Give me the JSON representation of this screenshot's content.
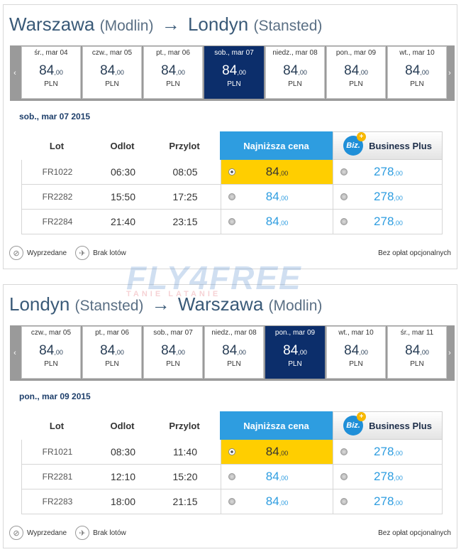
{
  "outbound": {
    "route": {
      "from": "Warszawa",
      "from_sub": "(Modlin)",
      "arrow": "→",
      "to": "Londyn",
      "to_sub": "(Stansted)"
    },
    "nav": {
      "prev": "‹",
      "next": "›"
    },
    "days": [
      {
        "label": "śr., mar 04",
        "price": "84",
        "decimals": ",00",
        "currency": "PLN",
        "selected": false
      },
      {
        "label": "czw., mar 05",
        "price": "84",
        "decimals": ",00",
        "currency": "PLN",
        "selected": false
      },
      {
        "label": "pt., mar 06",
        "price": "84",
        "decimals": ",00",
        "currency": "PLN",
        "selected": false
      },
      {
        "label": "sob., mar 07",
        "price": "84",
        "decimals": ",00",
        "currency": "PLN",
        "selected": true
      },
      {
        "label": "niedz., mar 08",
        "price": "84",
        "decimals": ",00",
        "currency": "PLN",
        "selected": false
      },
      {
        "label": "pon., mar 09",
        "price": "84",
        "decimals": ",00",
        "currency": "PLN",
        "selected": false
      },
      {
        "label": "wt., mar 10",
        "price": "84",
        "decimals": ",00",
        "currency": "PLN",
        "selected": false
      }
    ],
    "selected_date": "sob., mar 07 2015",
    "headers": {
      "flight": "Lot",
      "departure": "Odlot",
      "arrival": "Przylot",
      "lowest": "Najniższa cena",
      "biz_logo": "Biz.",
      "business": "Business Plus"
    },
    "flights": [
      {
        "code": "FR1022",
        "departure": "06:30",
        "arrival": "08:05",
        "low_price": "84",
        "low_dec": ",00",
        "biz_price": "278",
        "biz_dec": ",00",
        "selected": true
      },
      {
        "code": "FR2282",
        "departure": "15:50",
        "arrival": "17:25",
        "low_price": "84",
        "low_dec": ",00",
        "biz_price": "278",
        "biz_dec": ",00",
        "selected": false
      },
      {
        "code": "FR2284",
        "departure": "21:40",
        "arrival": "23:15",
        "low_price": "84",
        "low_dec": ",00",
        "biz_price": "278",
        "biz_dec": ",00",
        "selected": false
      }
    ],
    "legend": {
      "sold_out": "Wyprzedane",
      "no_flights": "Brak lotów",
      "fees": "Bez opłat opcjonalnych"
    }
  },
  "return": {
    "route": {
      "from": "Londyn",
      "from_sub": "(Stansted)",
      "arrow": "→",
      "to": "Warszawa",
      "to_sub": "(Modlin)"
    },
    "nav": {
      "prev": "‹",
      "next": "›"
    },
    "days": [
      {
        "label": "czw., mar 05",
        "price": "84",
        "decimals": ",00",
        "currency": "PLN",
        "selected": false
      },
      {
        "label": "pt., mar 06",
        "price": "84",
        "decimals": ",00",
        "currency": "PLN",
        "selected": false
      },
      {
        "label": "sob., mar 07",
        "price": "84",
        "decimals": ",00",
        "currency": "PLN",
        "selected": false
      },
      {
        "label": "niedz., mar 08",
        "price": "84",
        "decimals": ",00",
        "currency": "PLN",
        "selected": false
      },
      {
        "label": "pon., mar 09",
        "price": "84",
        "decimals": ",00",
        "currency": "PLN",
        "selected": true
      },
      {
        "label": "wt., mar 10",
        "price": "84",
        "decimals": ",00",
        "currency": "PLN",
        "selected": false
      },
      {
        "label": "śr., mar 11",
        "price": "84",
        "decimals": ",00",
        "currency": "PLN",
        "selected": false
      }
    ],
    "selected_date": "pon., mar 09 2015",
    "headers": {
      "flight": "Lot",
      "departure": "Odlot",
      "arrival": "Przylot",
      "lowest": "Najniższa cena",
      "biz_logo": "Biz.",
      "business": "Business Plus"
    },
    "flights": [
      {
        "code": "FR1021",
        "departure": "08:30",
        "arrival": "11:40",
        "low_price": "84",
        "low_dec": ",00",
        "biz_price": "278",
        "biz_dec": ",00",
        "selected": true
      },
      {
        "code": "FR2281",
        "departure": "12:10",
        "arrival": "15:20",
        "low_price": "84",
        "low_dec": ",00",
        "biz_price": "278",
        "biz_dec": ",00",
        "selected": false
      },
      {
        "code": "FR2283",
        "departure": "18:00",
        "arrival": "21:15",
        "low_price": "84",
        "low_dec": ",00",
        "biz_price": "278",
        "biz_dec": ",00",
        "selected": false
      }
    ],
    "legend": {
      "sold_out": "Wyprzedane",
      "no_flights": "Brak lotów",
      "fees": "Bez opłat opcjonalnych"
    }
  },
  "watermark": {
    "text": "FLY4FREE",
    "sub": "TANIE LATANIE"
  },
  "colors": {
    "selected_day": "#0c2e6b",
    "lowest_header": "#2e9de0",
    "selected_fare": "#ffce00",
    "fare_text": "#2e9de0"
  }
}
